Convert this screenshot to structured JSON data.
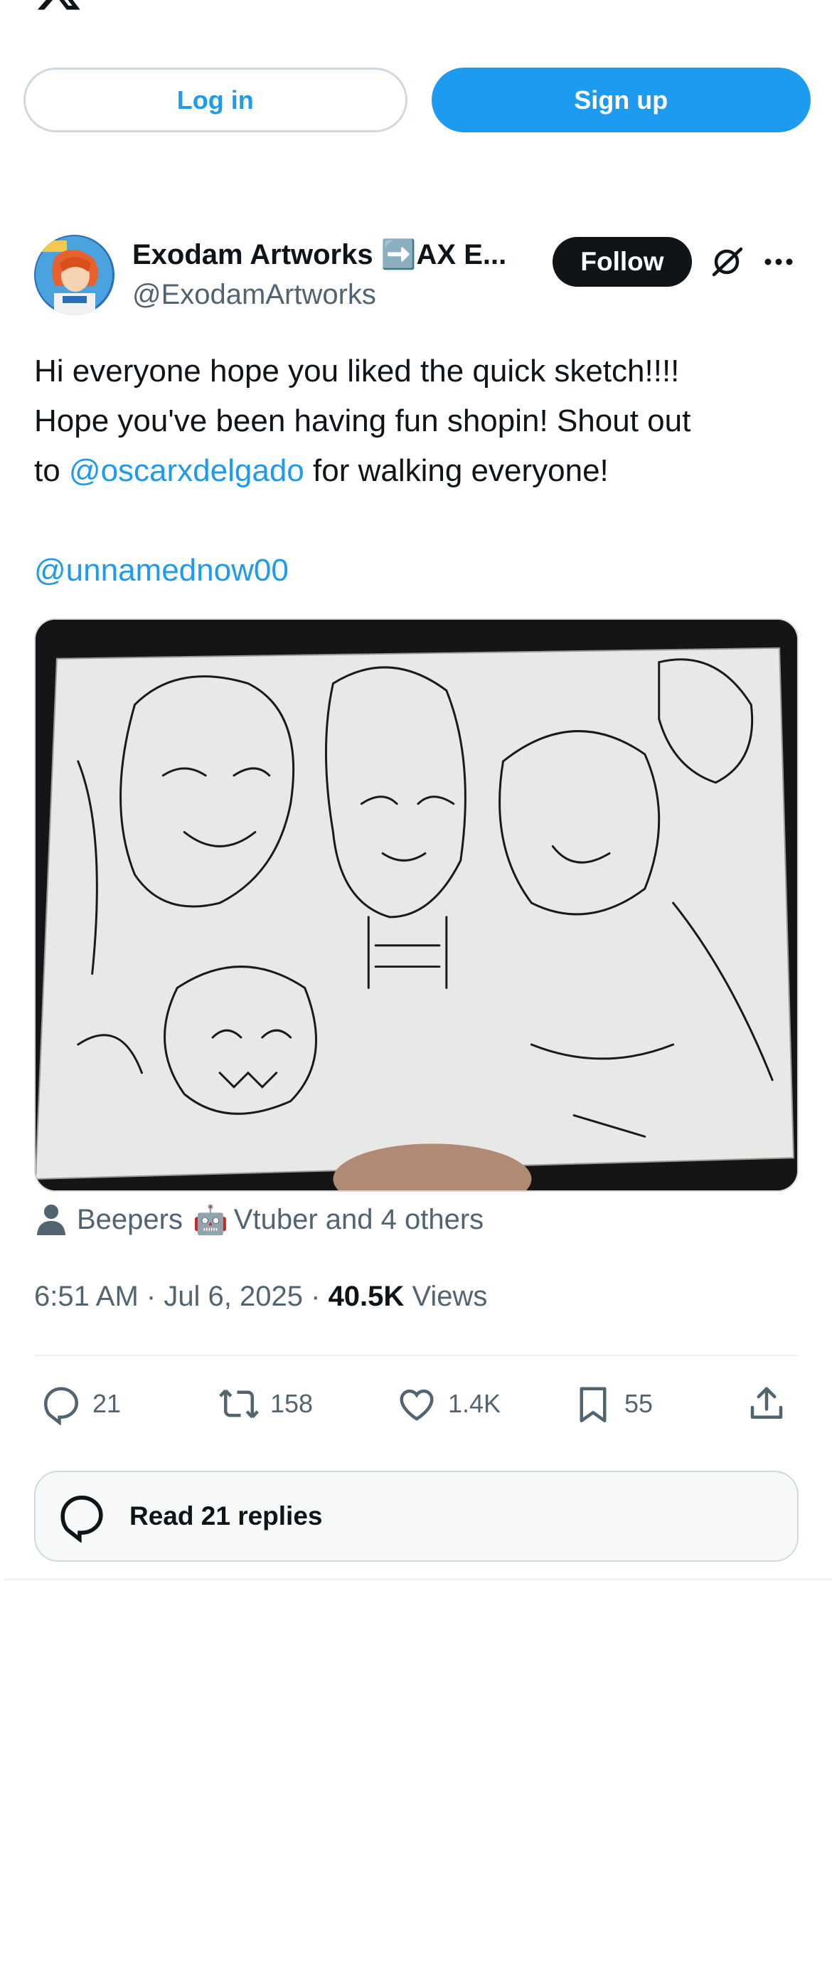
{
  "topbar": {
    "logo_icon": "x-logo-icon",
    "login_label": "Log in",
    "signup_label": "Sign up"
  },
  "tweet": {
    "author": {
      "display_name": "Exodam Artworks ➡️AX E...",
      "handle": "@ExodamArtworks",
      "avatar_icon": "avatar"
    },
    "follow_label": "Follow",
    "text": {
      "line1": "Hi everyone hope you liked the quick sketch!!!!",
      "line2": "Hope you've been having fun shopin! Shout out",
      "line3_prefix": "to ",
      "line3_mention": "@oscarxdelgado",
      "line3_suffix": " for walking everyone!",
      "mention2": "@unnamednow00"
    },
    "tags": {
      "first": "Beepers",
      "robot_emoji": "🤖",
      "rest": "Vtuber and 4 others"
    },
    "meta": {
      "time": "6:51 AM",
      "date": "Jul 6, 2025",
      "views_count": "40.5K",
      "views_label": "Views"
    },
    "actions": {
      "replies": "21",
      "reposts": "158",
      "likes": "1.4K",
      "bookmarks": "55"
    },
    "read_replies_label": "Read 21 replies"
  },
  "colors": {
    "accent": "#1d9bf0",
    "text_primary": "#0f1419",
    "text_secondary": "#536471",
    "border": "#cfd9de"
  }
}
